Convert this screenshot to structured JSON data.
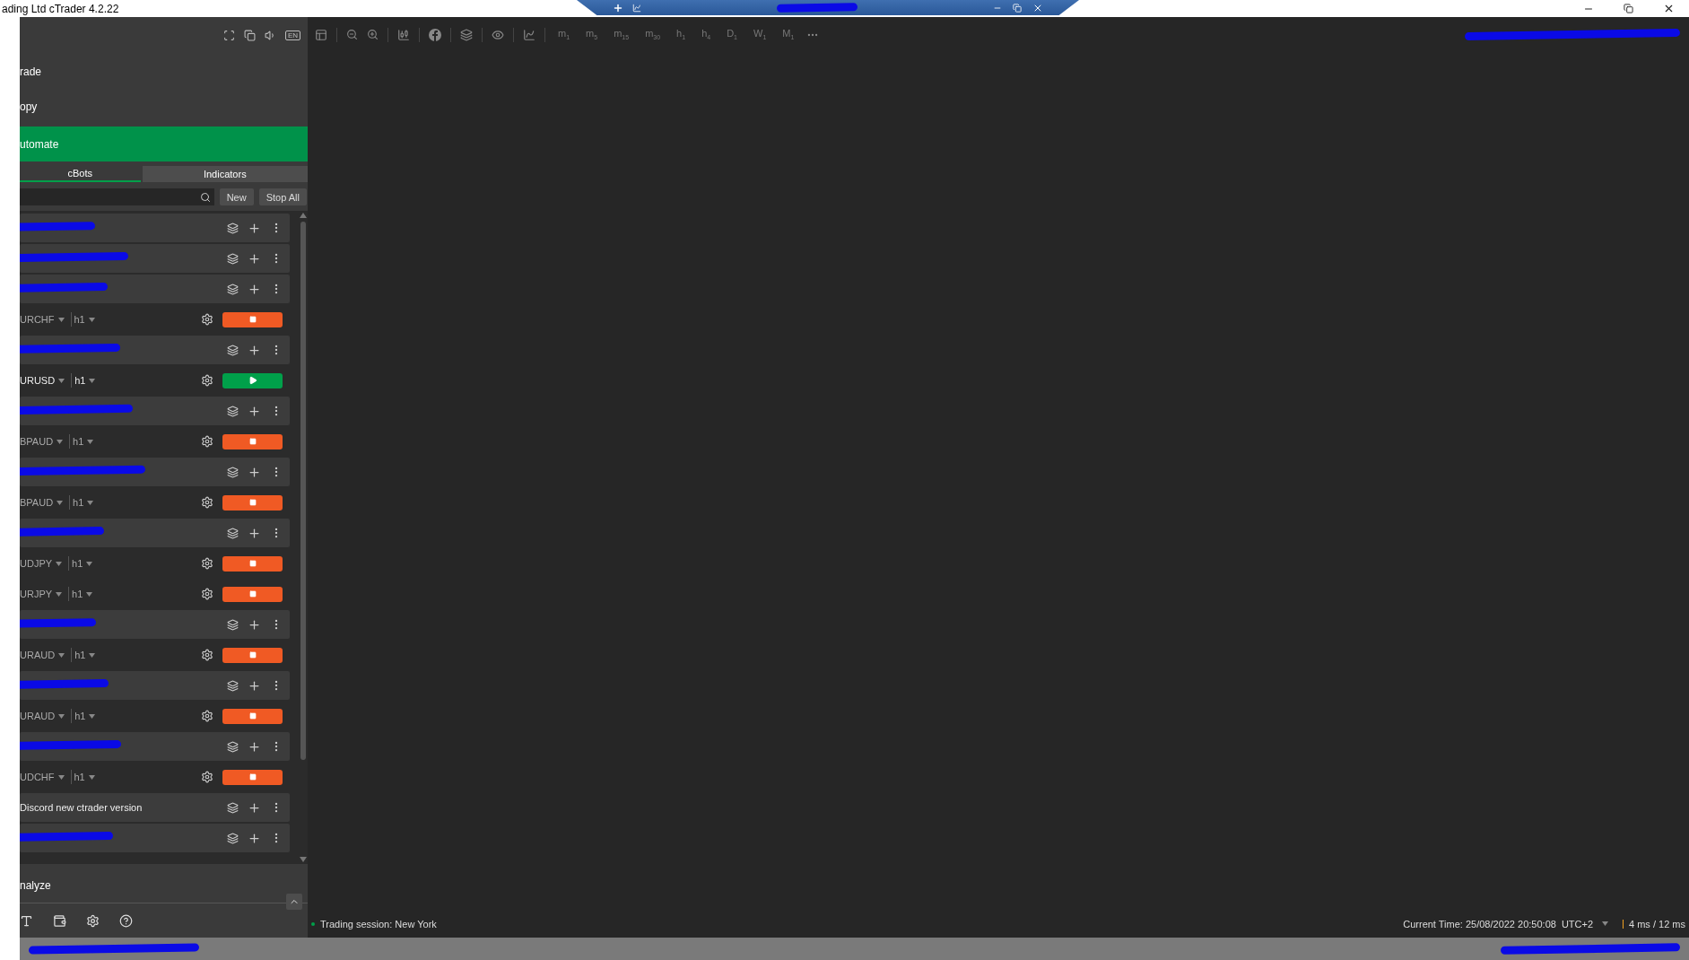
{
  "window": {
    "title": "ading Ltd cTrader 4.2.22"
  },
  "remote_bar": {
    "title_redacted": true
  },
  "nav": [
    {
      "label": "rade",
      "selected": false
    },
    {
      "label": "opy",
      "selected": false
    },
    {
      "label": "utomate",
      "selected": true
    }
  ],
  "tabs": [
    {
      "label": "cBots",
      "selected": true
    },
    {
      "label": "Indicators",
      "selected": false
    }
  ],
  "language": "EN",
  "buttons": [
    "New",
    "Stop All"
  ],
  "rows": [
    {
      "kind": "bot",
      "redacted": true
    },
    {
      "kind": "bot",
      "redacted": true
    },
    {
      "kind": "bot",
      "redacted": true
    },
    {
      "kind": "instance",
      "symbol": "URCHF",
      "timeframe": "h1",
      "running": true
    },
    {
      "kind": "bot",
      "redacted": true
    },
    {
      "kind": "instance",
      "symbol": "URUSD",
      "timeframe": "h1",
      "running": false
    },
    {
      "kind": "bot",
      "redacted": true
    },
    {
      "kind": "instance",
      "symbol": "BPAUD",
      "timeframe": "h1",
      "running": true
    },
    {
      "kind": "bot",
      "redacted": true
    },
    {
      "kind": "instance",
      "symbol": "BPAUD",
      "timeframe": "h1",
      "running": true
    },
    {
      "kind": "bot",
      "redacted": true
    },
    {
      "kind": "instance",
      "symbol": "UDJPY",
      "timeframe": "h1",
      "running": true
    },
    {
      "kind": "instance",
      "symbol": "URJPY",
      "timeframe": "h1",
      "running": true
    },
    {
      "kind": "bot",
      "redacted": true
    },
    {
      "kind": "instance",
      "symbol": "URAUD",
      "timeframe": "h1",
      "running": true
    },
    {
      "kind": "bot",
      "redacted": true
    },
    {
      "kind": "instance",
      "symbol": "URAUD",
      "timeframe": "h1",
      "running": true
    },
    {
      "kind": "bot",
      "redacted": true
    },
    {
      "kind": "instance",
      "symbol": "UDCHF",
      "timeframe": "h1",
      "running": true
    },
    {
      "kind": "bot",
      "name": "Discord new ctrader version",
      "redacted": false
    },
    {
      "kind": "bot",
      "redacted": true
    }
  ],
  "analyze": {
    "label": "nalyze"
  },
  "timeframes": [
    {
      "label": "m",
      "sub": "1"
    },
    {
      "label": "m",
      "sub": "5"
    },
    {
      "label": "m",
      "sub": "15"
    },
    {
      "label": "m",
      "sub": "30"
    },
    {
      "label": "h",
      "sub": "1"
    },
    {
      "label": "h",
      "sub": "4"
    },
    {
      "label": "D",
      "sub": "1"
    },
    {
      "label": "W",
      "sub": "1"
    },
    {
      "label": "M",
      "sub": "1"
    }
  ],
  "status_bar": {
    "session": "Trading session: New York",
    "current_time": "Current Time:  25/08/2022 20:50:08",
    "timezone": "UTC+2",
    "latency": "4 ms / 12 ms"
  }
}
